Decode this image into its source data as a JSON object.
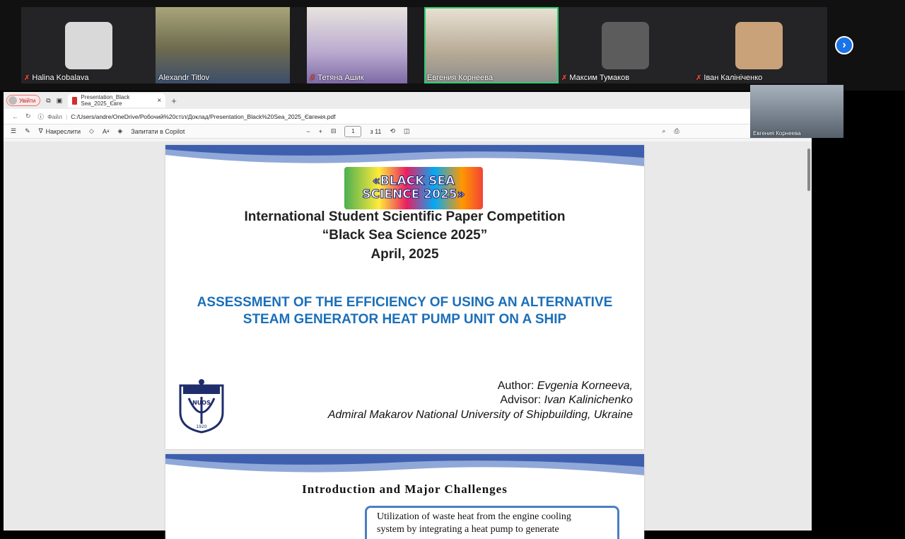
{
  "participants": [
    {
      "name": "Halina Kobalava",
      "muted": true,
      "type": "avatar",
      "color": "#cfcfcf"
    },
    {
      "name": "Alexandr Titlov",
      "muted": false,
      "type": "video",
      "color": "#8a8560"
    },
    {
      "name": "Тетяна Ашик",
      "muted": true,
      "type": "video",
      "color": "#9a8fb7"
    },
    {
      "name": "Евгения Корнеева",
      "muted": false,
      "type": "video",
      "active": true,
      "color": "#c7b89b"
    },
    {
      "name": "Максим Тумаков",
      "muted": true,
      "type": "avatar",
      "color": "#6f6f6f"
    },
    {
      "name": "Іван Калініченко",
      "muted": true,
      "type": "avatar",
      "color": "#c79a6a"
    }
  ],
  "self_view": {
    "name": "Евгения Корнеева"
  },
  "browser": {
    "profile_label": "Увійти",
    "tab_title": "Presentation_Black Sea_2025_Євге",
    "add_tab": "+",
    "file_label": "Файл",
    "url": "C:/Users/andre/OneDrive/Робочий%20стіл/Доклад/Presentation_Black%20Sea_2025_Євгенія.pdf",
    "draw_label": "Накреслити",
    "copilot_label": "Запитати в Copilot",
    "page_current": "1",
    "page_total": "з 11"
  },
  "slide1": {
    "logo_line1": "«BLACK SEA",
    "logo_line2": "SCIENCE 2025»",
    "line1": "International Student Scientific Paper Competition",
    "line2": "“Black Sea Science 2025”",
    "line3": "April, 2025",
    "title_line1": "ASSESSMENT OF THE EFFICIENCY OF USING AN ALTERNATIVE",
    "title_line2": "STEAM GENERATOR HEAT PUMP UNIT ON A SHIP",
    "author_label": "Author:",
    "author_name": "Evgenia Korneeva,",
    "advisor_label": "Advisor:",
    "advisor_name": "Ivan Kalinichenko",
    "university": "Admiral Makarov National University of Shipbuilding, Ukraine",
    "crest_text": "NUOS",
    "crest_year": "1920"
  },
  "slide2": {
    "title": "Introduction and Major Challenges",
    "box_line1": "Utilization of waste heat from the engine cooling",
    "box_line2": "system by integrating a heat pump to generate"
  },
  "colors": {
    "accent": "#1b6fb9",
    "active_tile": "#2ecc71",
    "next_button": "#1a73e8"
  }
}
